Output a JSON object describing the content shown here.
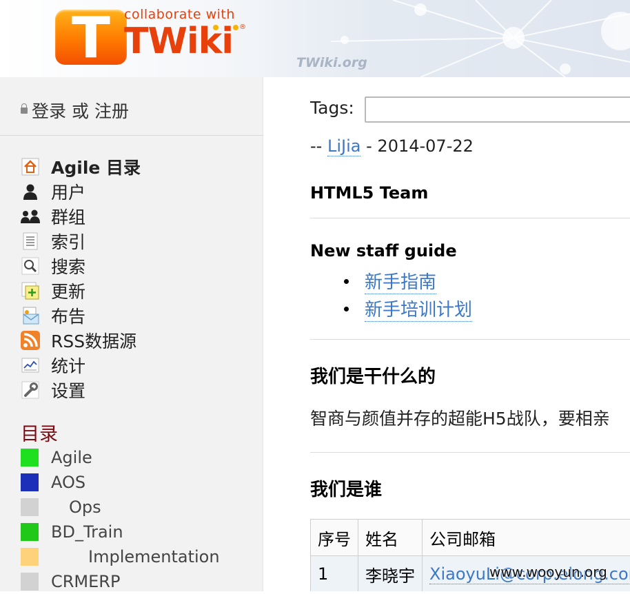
{
  "header": {
    "logo_letter": "T",
    "logo_tagline": "collaborate with",
    "logo_word": "TWiki",
    "logo_reg": "®",
    "site_url": "TWiki.org"
  },
  "sidebar": {
    "login": {
      "login_label": "登录",
      "or_label": "或",
      "register_label": "注册"
    },
    "nav_items": [
      {
        "label": "Agile 目录",
        "icon": "home-icon"
      },
      {
        "label": "用户",
        "icon": "user-icon"
      },
      {
        "label": "群组",
        "icon": "group-icon"
      },
      {
        "label": "索引",
        "icon": "index-icon"
      },
      {
        "label": "搜索",
        "icon": "search-icon"
      },
      {
        "label": "更新",
        "icon": "changes-icon"
      },
      {
        "label": "布告",
        "icon": "notify-icon"
      },
      {
        "label": "RSS数据源",
        "icon": "rss-icon"
      },
      {
        "label": "统计",
        "icon": "statistics-icon"
      },
      {
        "label": "设置",
        "icon": "wrench-icon"
      }
    ],
    "categories_title": "目录",
    "categories": [
      {
        "label": "Agile",
        "color": "#1ee01e",
        "indent": 0
      },
      {
        "label": "AOS",
        "color": "#1b2fb8",
        "indent": 0
      },
      {
        "label": "Ops",
        "color": "#d2d2d2",
        "indent": 1
      },
      {
        "label": "BD_Train",
        "color": "#20c81a",
        "indent": 0
      },
      {
        "label": "Implementation",
        "color": "#fdd27a",
        "indent": 2
      },
      {
        "label": "CRMERP",
        "color": "#d2d2d2",
        "indent": 0
      }
    ]
  },
  "main": {
    "tags_label": "Tags:",
    "byline_prefix": "--",
    "author": "LiJia",
    "byline_sep": "-",
    "date": "2014-07-22",
    "team_heading": "HTML5 Team",
    "guide_heading": "New staff guide",
    "guide_links": [
      "新手指南",
      "新手培训计划"
    ],
    "what_heading": "我们是干什么的",
    "what_text": "智商与颜值并存的超能H5战队，要相亲",
    "who_heading": "我们是谁",
    "table": {
      "headers": [
        "序号",
        "姓名",
        "公司邮箱"
      ],
      "rows": [
        {
          "num": "1",
          "name": "李晓宇",
          "email": "XiaoyuLi@corp.elong.com"
        }
      ]
    }
  },
  "watermark": "www.wooyun.org"
}
